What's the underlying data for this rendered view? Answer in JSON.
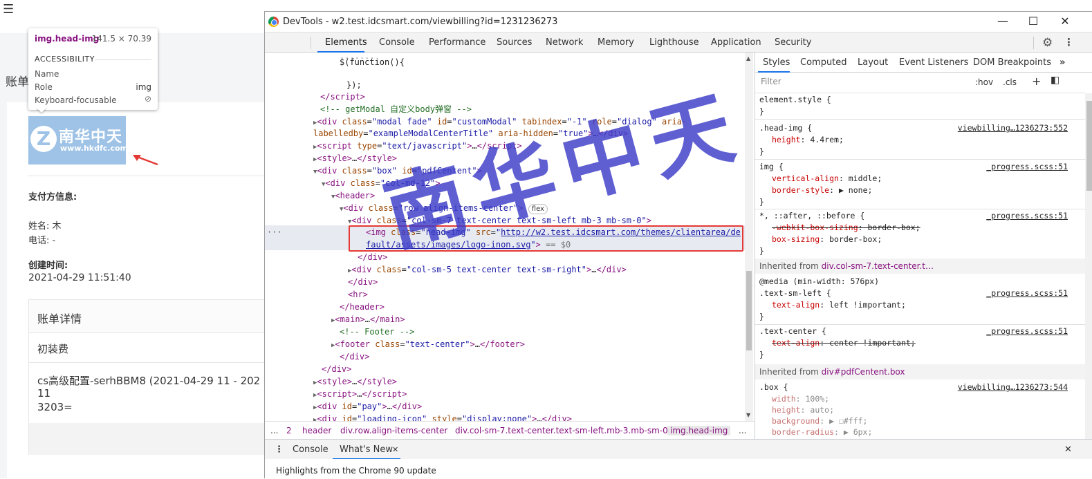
{
  "page": {
    "menu_icon": "hamburger-menu-icon",
    "title": "账单",
    "logo_cn": "南华中天",
    "logo_url": "www.hkdfc.com",
    "payer_label": "支付方信息:",
    "name_label": "姓名: 木",
    "phone_label": "电话: -",
    "created_label": "创建时间:",
    "created_value": "2021-04-29 11:51:40",
    "detail_title": "账单详情",
    "detail_item1": "初装费",
    "detail_item2_l1": "cs高级配置-serhBBM8 (2021-04-29 11 - 202",
    "detail_item2_l2": "11",
    "detail_item2_l3": "3203="
  },
  "tooltip": {
    "selector": "img.head-img",
    "dims": "141.5 × 70.39",
    "section": "ACCESSIBILITY",
    "name_k": "Name",
    "role_k": "Role",
    "role_v": "img",
    "focus_k": "Keyboard-focusable"
  },
  "devtools": {
    "window_title": "DevTools - w2.test.idcsmart.com/viewbilling?id=1231236273",
    "tabs": [
      "Elements",
      "Console",
      "Performance",
      "Sources",
      "Network",
      "Memory",
      "Lighthouse",
      "Application",
      "Security"
    ],
    "styles_tabs": [
      "Styles",
      "Computed",
      "Layout",
      "Event Listeners",
      "DOM Breakpoints",
      "»"
    ],
    "filter_placeholder": "Filter",
    "hov": ":hov",
    "cls": ".cls",
    "breadcrumb": [
      "...",
      "2",
      "header",
      "div.row.align-items-center",
      "div.col-sm-7.text-center.text-sm-left.mb-3.mb-sm-0",
      "img.head-img",
      "..."
    ],
    "console_tabs": [
      "Console",
      "What's New"
    ],
    "console_msg": "Highlights from the Chrome 90 update",
    "watermark": "南华中天"
  },
  "colors": {
    "accent": "#1a73e8",
    "tag": "#881280",
    "attr": "#994500",
    "value": "#1a1aa6",
    "highlight_box": "#e53935",
    "watermark": "#3c3cc8"
  }
}
